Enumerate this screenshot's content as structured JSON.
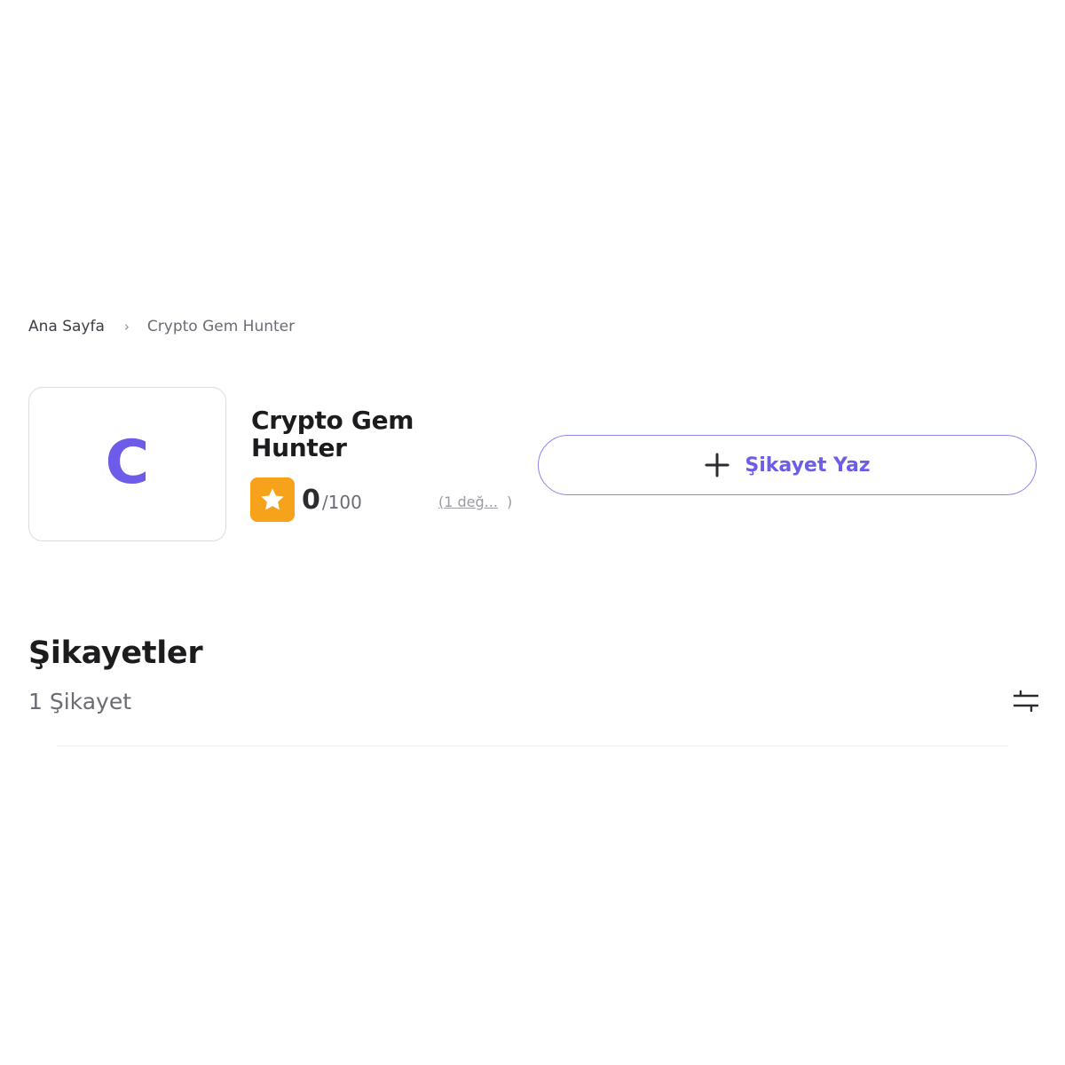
{
  "breadcrumb": {
    "home": "Ana Sayfa",
    "separator": "›",
    "current": "Crypto Gem Hunter"
  },
  "company": {
    "logo_letter": "C",
    "name": "Crypto Gem Hunter",
    "score": "0",
    "score_max": "/100",
    "reviews_open": "(",
    "reviews_text": "1 değ...",
    "reviews_close": ")"
  },
  "actions": {
    "write_complaint_label": "Şikayet Yaz"
  },
  "complaints": {
    "title": "Şikayetler",
    "count_text": "1 Şikayet"
  },
  "icons": {
    "star": "star-icon",
    "plus": "plus-icon",
    "filter": "filter-sliders-icon"
  },
  "colors": {
    "accent": "#6c5ce7",
    "star_badge": "#f7a21b",
    "button_border": "#8c84ee"
  }
}
